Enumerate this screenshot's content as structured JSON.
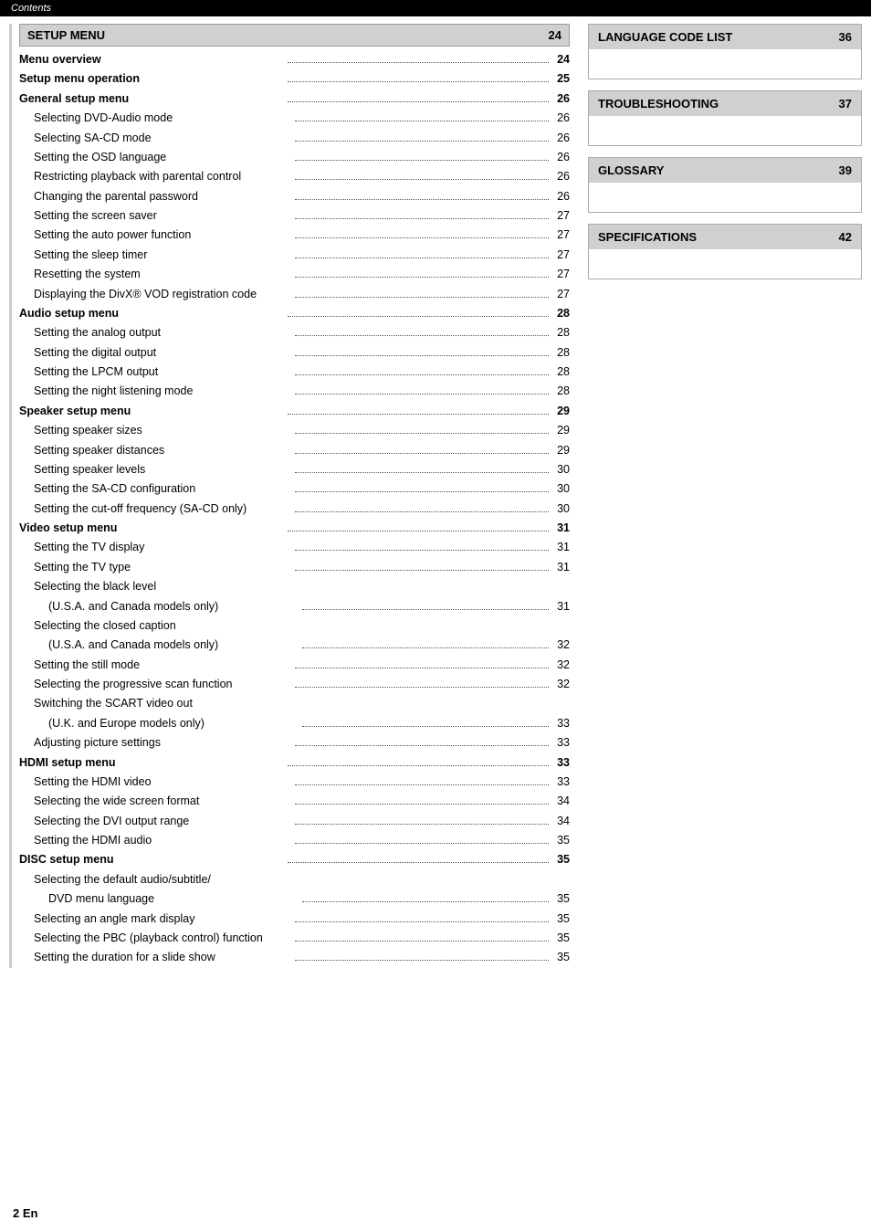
{
  "header": {
    "label": "Contents"
  },
  "footer": {
    "text": "2 En"
  },
  "left_section": {
    "title": "SETUP MENU",
    "page": "24",
    "items": [
      {
        "label": "Menu overview",
        "dots": true,
        "page": "24",
        "bold": true,
        "indent": 1
      },
      {
        "label": "Setup menu operation",
        "dots": true,
        "page": "25",
        "bold": true,
        "indent": 1
      },
      {
        "label": "General setup menu",
        "dots": true,
        "page": "26",
        "bold": true,
        "indent": 1
      },
      {
        "label": "Selecting DVD-Audio mode",
        "dots": true,
        "page": "26",
        "bold": false,
        "indent": 2
      },
      {
        "label": "Selecting SA-CD mode",
        "dots": true,
        "page": "26",
        "bold": false,
        "indent": 2
      },
      {
        "label": "Setting the OSD language",
        "dots": true,
        "page": "26",
        "bold": false,
        "indent": 2
      },
      {
        "label": "Restricting playback with parental control",
        "dots": true,
        "page": "26",
        "bold": false,
        "indent": 2
      },
      {
        "label": "Changing the parental password",
        "dots": true,
        "page": "26",
        "bold": false,
        "indent": 2
      },
      {
        "label": "Setting the screen saver",
        "dots": true,
        "page": "27",
        "bold": false,
        "indent": 2
      },
      {
        "label": "Setting the auto power function",
        "dots": true,
        "page": "27",
        "bold": false,
        "indent": 2
      },
      {
        "label": "Setting the sleep timer",
        "dots": true,
        "page": "27",
        "bold": false,
        "indent": 2
      },
      {
        "label": "Resetting the system",
        "dots": true,
        "page": "27",
        "bold": false,
        "indent": 2
      },
      {
        "label": "Displaying the DivX® VOD registration code",
        "dots": true,
        "page": "27",
        "bold": false,
        "indent": 2
      },
      {
        "label": "Audio setup menu",
        "dots": true,
        "page": "28",
        "bold": true,
        "indent": 1
      },
      {
        "label": "Setting the analog output",
        "dots": true,
        "page": "28",
        "bold": false,
        "indent": 2
      },
      {
        "label": "Setting the digital output",
        "dots": true,
        "page": "28",
        "bold": false,
        "indent": 2
      },
      {
        "label": "Setting the LPCM output",
        "dots": true,
        "page": "28",
        "bold": false,
        "indent": 2
      },
      {
        "label": "Setting the night listening mode",
        "dots": true,
        "page": "28",
        "bold": false,
        "indent": 2
      },
      {
        "label": "Speaker setup menu",
        "dots": true,
        "page": "29",
        "bold": true,
        "indent": 1
      },
      {
        "label": "Setting speaker sizes",
        "dots": true,
        "page": "29",
        "bold": false,
        "indent": 2
      },
      {
        "label": "Setting speaker distances",
        "dots": true,
        "page": "29",
        "bold": false,
        "indent": 2
      },
      {
        "label": "Setting speaker levels",
        "dots": true,
        "page": "30",
        "bold": false,
        "indent": 2
      },
      {
        "label": "Setting the SA-CD configuration",
        "dots": true,
        "page": "30",
        "bold": false,
        "indent": 2
      },
      {
        "label": "Setting the cut-off frequency (SA-CD only)",
        "dots": true,
        "page": "30",
        "bold": false,
        "indent": 2
      },
      {
        "label": "Video setup menu",
        "dots": true,
        "page": "31",
        "bold": true,
        "indent": 1
      },
      {
        "label": "Setting the TV display",
        "dots": true,
        "page": "31",
        "bold": false,
        "indent": 2
      },
      {
        "label": "Setting the TV type",
        "dots": true,
        "page": "31",
        "bold": false,
        "indent": 2
      },
      {
        "label": "Selecting the black level",
        "dots": false,
        "page": "",
        "bold": false,
        "indent": 2
      },
      {
        "label": "(U.S.A. and Canada models only)",
        "dots": true,
        "page": "31",
        "bold": false,
        "indent": 3
      },
      {
        "label": "Selecting the closed caption",
        "dots": false,
        "page": "",
        "bold": false,
        "indent": 2
      },
      {
        "label": "(U.S.A. and Canada models only)",
        "dots": true,
        "page": "32",
        "bold": false,
        "indent": 3
      },
      {
        "label": "Setting the still mode",
        "dots": true,
        "page": "32",
        "bold": false,
        "indent": 2
      },
      {
        "label": "Selecting the progressive scan function",
        "dots": true,
        "page": "32",
        "bold": false,
        "indent": 2
      },
      {
        "label": "Switching the SCART video out",
        "dots": false,
        "page": "",
        "bold": false,
        "indent": 2
      },
      {
        "label": "(U.K. and Europe models only)",
        "dots": true,
        "page": "33",
        "bold": false,
        "indent": 3
      },
      {
        "label": "Adjusting picture settings",
        "dots": true,
        "page": "33",
        "bold": false,
        "indent": 2
      },
      {
        "label": "HDMI setup menu",
        "dots": true,
        "page": "33",
        "bold": true,
        "indent": 1
      },
      {
        "label": "Setting the HDMI video",
        "dots": true,
        "page": "33",
        "bold": false,
        "indent": 2
      },
      {
        "label": "Selecting the wide screen format",
        "dots": true,
        "page": "34",
        "bold": false,
        "indent": 2
      },
      {
        "label": "Selecting the DVI output range",
        "dots": true,
        "page": "34",
        "bold": false,
        "indent": 2
      },
      {
        "label": "Setting the HDMI audio",
        "dots": true,
        "page": "35",
        "bold": false,
        "indent": 2
      },
      {
        "label": "DISC setup menu",
        "dots": true,
        "page": "35",
        "bold": true,
        "indent": 1
      },
      {
        "label": "Selecting the default audio/subtitle/",
        "dots": false,
        "page": "",
        "bold": false,
        "indent": 2
      },
      {
        "label": "DVD menu language",
        "dots": true,
        "page": "35",
        "bold": false,
        "indent": 3
      },
      {
        "label": "Selecting an angle mark display",
        "dots": true,
        "page": "35",
        "bold": false,
        "indent": 2
      },
      {
        "label": "Selecting the PBC (playback control) function",
        "dots": true,
        "page": "35",
        "bold": false,
        "indent": 2
      },
      {
        "label": "Setting the duration for a slide show",
        "dots": true,
        "page": "35",
        "bold": false,
        "indent": 2
      }
    ]
  },
  "right_sections": [
    {
      "title": "LANGUAGE CODE LIST",
      "page": "36",
      "content": ""
    },
    {
      "title": "TROUBLESHOOTING",
      "page": "37",
      "content": ""
    },
    {
      "title": "GLOSSARY",
      "page": "39",
      "content": ""
    },
    {
      "title": "SPECIFICATIONS",
      "page": "42",
      "content": ""
    }
  ]
}
